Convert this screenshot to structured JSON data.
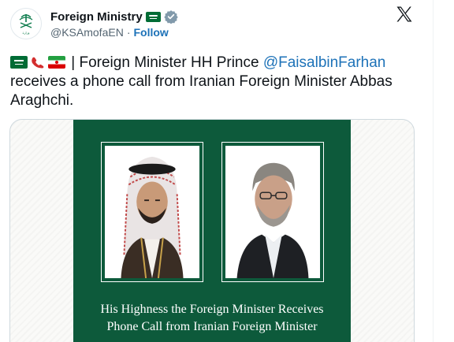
{
  "account": {
    "display_name": "Foreign Ministry",
    "handle": "@KSAmofaEN",
    "separator": "·",
    "follow_label": "Follow",
    "avatar_icon": "ministry-emblem-icon",
    "flag_icon": "saudi-flag-icon",
    "verified_icon": "verified-badge-icon"
  },
  "platform": {
    "logo_icon": "x-logo-icon"
  },
  "tweet": {
    "emojis": [
      "saudi-flag-emoji",
      "telephone-emoji",
      "iran-flag-emoji"
    ],
    "text_before_mention": " | Foreign Minister HH Prince ",
    "mention": "@FaisalbinFarhan",
    "text_after_mention": " receives a phone call from Iranian Foreign Minister Abbas Araghchi."
  },
  "media": {
    "caption_line1": "His Highness the Foreign Minister Receives",
    "caption_line2": "Phone Call from Iranian Foreign Minister",
    "colors": {
      "panel_green": "#0d5a3b",
      "frame": "#ffffff"
    }
  },
  "colors": {
    "link": "#1d72b8",
    "text": "#0f1419",
    "muted": "#536471"
  }
}
